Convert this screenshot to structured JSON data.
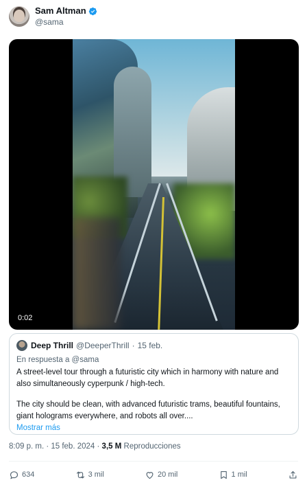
{
  "author": {
    "display_name": "Sam Altman",
    "handle": "@sama",
    "verified_icon": "verified-badge-icon",
    "verified_color": "#1d9bf0"
  },
  "video": {
    "timestamp": "0:02"
  },
  "quoted_tweet": {
    "display_name": "Deep Thrill",
    "handle": "@DeeperThrill",
    "separator": "·",
    "date": "15 feb.",
    "reply_to": "En respuesta a @sama",
    "paragraph_1": "A street-level tour through a futuristic city which in harmony with nature and also simultaneously cyperpunk / high-tech.",
    "paragraph_2": "The city should be clean, with advanced futuristic trams, beautiful fountains, giant holograms everywhere, and robots all over....",
    "show_more": "Mostrar más"
  },
  "meta": {
    "time_date": "8:09 p. m. · 15 feb. 2024 ·",
    "views_count": "3,5 M",
    "views_label": "Reproducciones"
  },
  "actions": {
    "replies": "634",
    "reposts": "3 mil",
    "likes": "20 mil",
    "bookmarks": "1 mil"
  },
  "colors": {
    "text_primary": "#0f1419",
    "text_secondary": "#536471",
    "accent": "#1d9bf0",
    "border": "#cfd9de"
  }
}
